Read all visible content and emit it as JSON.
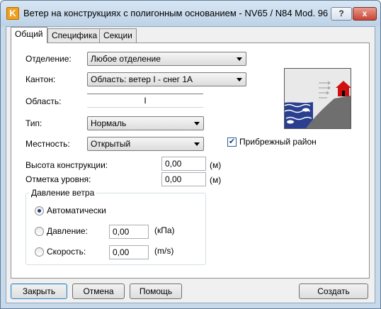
{
  "window": {
    "title": "Ветер на конструкциях с полигонным основанием - NV65 / N84 Mod. 96",
    "help_label": "?",
    "close_label": "x",
    "app_icon_label": "K"
  },
  "tabs": [
    {
      "label": "Общий"
    },
    {
      "label": "Специфика"
    },
    {
      "label": "Секции"
    }
  ],
  "general": {
    "department": {
      "label": "Отделение:",
      "value": "Любое отделение"
    },
    "canton": {
      "label": "Кантон:",
      "value": "Область: ветер I - снег 1А"
    },
    "region": {
      "label": "Область:",
      "value": "I"
    },
    "type": {
      "label": "Тип:",
      "value": "Нормаль"
    },
    "terrain": {
      "label": "Местность:",
      "value": "Открытый"
    },
    "coastal": {
      "label": "Прибрежный район",
      "checked": true
    },
    "height": {
      "label": "Высота конструкции:",
      "value": "0,00",
      "unit": "(м)"
    },
    "level": {
      "label": "Отметка уровня:",
      "value": "0,00",
      "unit": "(м)"
    }
  },
  "wind_pressure": {
    "title": "Давление ветра",
    "auto": {
      "label": "Автоматически",
      "selected": true
    },
    "pressure": {
      "label": "Давление:",
      "value": "0,00",
      "unit": "(кПа)",
      "selected": false
    },
    "speed": {
      "label": "Скорость:",
      "value": "0,00",
      "unit": "(m/s)",
      "selected": false
    }
  },
  "buttons": {
    "close": "Закрыть",
    "cancel": "Отмена",
    "help": "Помощь",
    "create": "Создать"
  },
  "icons": {
    "check_mark": "✔"
  },
  "colors": {
    "picture_sky": "#e9e9e9",
    "picture_ground": "#6f6f6f",
    "picture_water": "#2a3f8f",
    "house": "#d01010",
    "title_bar": "#c8d9ea"
  }
}
